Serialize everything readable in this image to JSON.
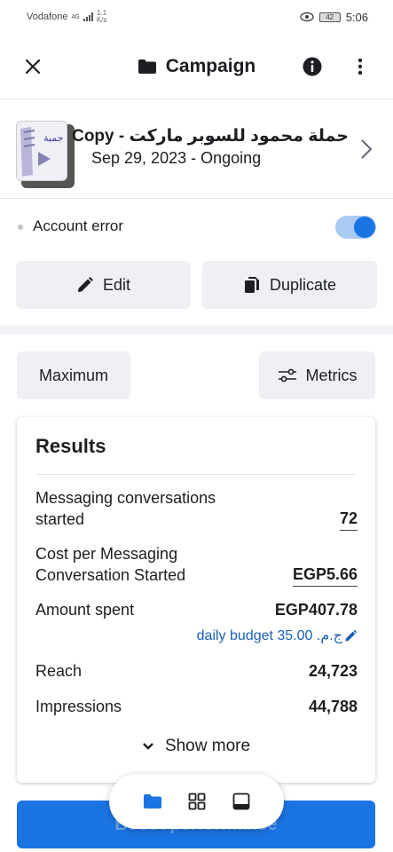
{
  "status_bar": {
    "carrier": "Vodafone",
    "network": "4G",
    "speed": "1.1",
    "speed_unit": "K/s",
    "battery": "42",
    "time": "5:06"
  },
  "header": {
    "title": "Campaign",
    "close_icon": "close-icon",
    "folder_icon": "folder-icon",
    "info_icon": "info-icon",
    "more_icon": "more-vertical-icon"
  },
  "campaign": {
    "name": "حملة محمود للسوبر ماركت - Copy",
    "date": "Sep 29, 2023 -",
    "status": "Ongoing",
    "thumbnail_text": "ج‍م‍ب‍ة"
  },
  "account": {
    "label": "Account error",
    "toggle_on": true
  },
  "actions": {
    "edit_label": "Edit",
    "duplicate_label": "Duplicate"
  },
  "filters": {
    "range_label": "Maximum",
    "metrics_label": "Metrics"
  },
  "results": {
    "title": "Results",
    "metrics": [
      {
        "label_line1": "Messaging conversations",
        "label_line2": "started",
        "value": "72"
      },
      {
        "label_line1": "Cost per Messaging",
        "label_line2": "Conversation Started",
        "value": "EGP5.66"
      },
      {
        "label_line1": "Amount spent",
        "label_line2": "",
        "value": "EGP407.78"
      },
      {
        "label_line1": "Reach",
        "label_line2": "",
        "value": "24,723"
      },
      {
        "label_line1": "Impressions",
        "label_line2": "",
        "value": "44,788"
      }
    ],
    "daily_budget": "daily budget ج.م.‏ 35.00",
    "show_more": "Show more"
  },
  "bottom": {
    "primary_button": "Boost performance"
  },
  "colors": {
    "accent": "#1b74e4",
    "link": "#1b5fb4",
    "button_gray": "#eef0f3"
  }
}
